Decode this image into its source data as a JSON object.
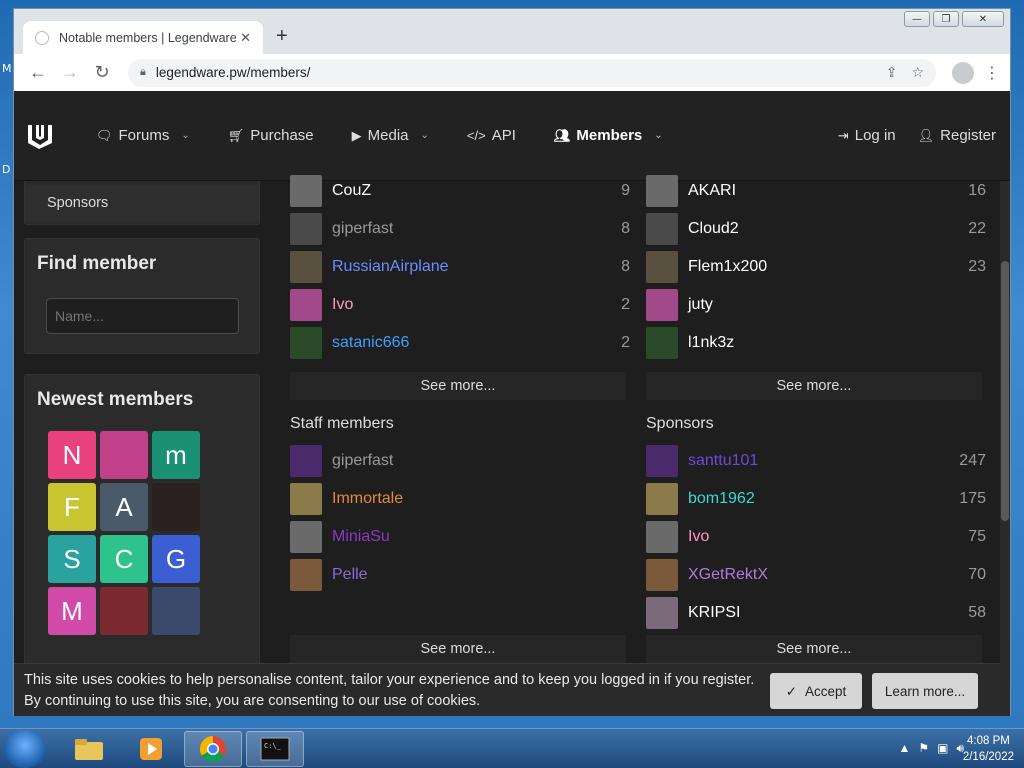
{
  "desktop": {
    "side_letters": [
      "M",
      "D"
    ]
  },
  "window": {
    "controls": [
      "—",
      "❐",
      "✕"
    ]
  },
  "browser": {
    "tab_title": "Notable members | Legendware",
    "url": "legendware.pw/members/"
  },
  "nav": {
    "items": [
      {
        "label": "Forums",
        "icon": "speech-bubble-icon",
        "chevron": true
      },
      {
        "label": "Purchase",
        "icon": "cart-icon",
        "chevron": false
      },
      {
        "label": "Media",
        "icon": "camera-icon",
        "chevron": true
      },
      {
        "label": "API",
        "icon": "code-icon",
        "chevron": false
      },
      {
        "label": "Members",
        "icon": "users-icon",
        "chevron": true
      }
    ],
    "login": "Log in",
    "register": "Register"
  },
  "sidebar": {
    "sponsors_link": "Sponsors",
    "find_member_title": "Find member",
    "name_placeholder": "Name...",
    "newest_title": "Newest members",
    "newest": [
      {
        "letter": "N",
        "color": "#e8427c"
      },
      {
        "letter": "",
        "color": "#c0408a"
      },
      {
        "letter": "m",
        "color": "#1a9074"
      },
      {
        "letter": "F",
        "color": "#c9c431"
      },
      {
        "letter": "A",
        "color": "#4a5a68"
      },
      {
        "letter": "",
        "color": "#2a2020"
      },
      {
        "letter": "S",
        "color": "#2aa3a0"
      },
      {
        "letter": "C",
        "color": "#2ec38c"
      },
      {
        "letter": "G",
        "color": "#3b5fd2"
      },
      {
        "letter": "M",
        "color": "#d24aa8"
      },
      {
        "letter": "",
        "color": "#7a2a30"
      },
      {
        "letter": "",
        "color": "#3a4a6a"
      }
    ]
  },
  "main": {
    "top_left": [
      {
        "name": "CouZ",
        "count": "9",
        "color": "#ffffff"
      },
      {
        "name": "giperfast",
        "count": "8",
        "color": "#9a9a9a"
      },
      {
        "name": "RussianAirplane",
        "count": "8",
        "color": "#6e8bff"
      },
      {
        "name": "Ivo",
        "count": "2",
        "color": "#ff9ac2"
      },
      {
        "name": "satanic666",
        "count": "2",
        "color": "#3ea0ff"
      }
    ],
    "top_right": [
      {
        "name": "AKARI",
        "count": "16",
        "color": "#ffffff"
      },
      {
        "name": "Cloud2",
        "count": "22",
        "color": "#ffffff"
      },
      {
        "name": "Flem1x200",
        "count": "23",
        "color": "#ffffff"
      },
      {
        "name": "juty",
        "count": "",
        "color": "#ffffff"
      },
      {
        "name": "l1nk3z",
        "count": "",
        "color": "#ffffff"
      }
    ],
    "see_more": "See more...",
    "staff_title": "Staff members",
    "staff": [
      {
        "name": "giperfast",
        "color": "#9a9a9a"
      },
      {
        "name": "Immortale",
        "color": "#e08a3a"
      },
      {
        "name": "MiniaSu",
        "color": "#8a3ac0"
      },
      {
        "name": "Pelle",
        "color": "#8a6ad8"
      }
    ],
    "sponsors_title": "Sponsors",
    "sponsors": [
      {
        "name": "santtu101",
        "count": "247",
        "color": "#6a4ad8"
      },
      {
        "name": "bom1962",
        "count": "175",
        "color": "#3ad8d0"
      },
      {
        "name": "Ivo",
        "count": "75",
        "color": "#ff9ac2"
      },
      {
        "name": "XGetRektX",
        "count": "70",
        "color": "#b07ad8"
      },
      {
        "name": "KRIPSI",
        "count": "58",
        "color": "#ffffff"
      }
    ]
  },
  "cookie": {
    "line1": "This site uses cookies to help personalise content, tailor your experience and to keep you logged in if you register.",
    "line2": "By continuing to use this site, you are consenting to our use of cookies.",
    "accept": "Accept",
    "learn_more": "Learn more..."
  },
  "taskbar": {
    "time": "4:08 PM",
    "date": "2/16/2022"
  }
}
